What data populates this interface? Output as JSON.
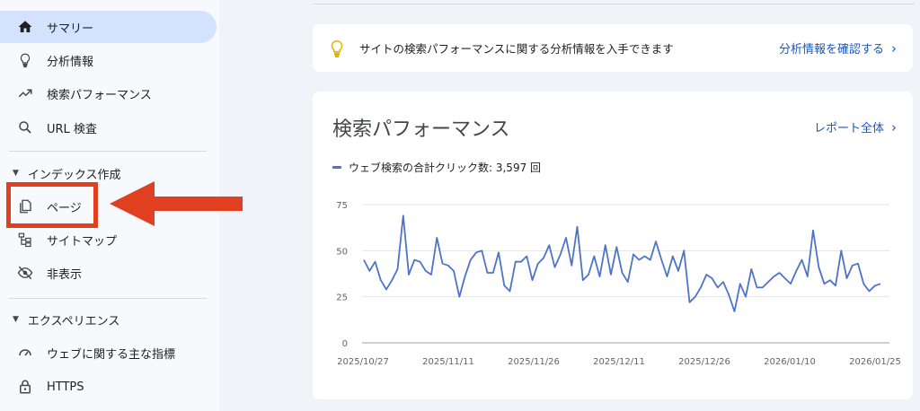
{
  "sidebar": {
    "items": [
      {
        "label": "サマリー",
        "icon": "home-icon",
        "active": true
      },
      {
        "label": "分析情報",
        "icon": "lightbulb-icon"
      },
      {
        "label": "検索パフォーマンス",
        "icon": "trending-up-icon"
      },
      {
        "label": "URL 検査",
        "icon": "search-icon"
      }
    ],
    "index_section": {
      "label": "インデックス作成",
      "items": [
        {
          "label": "ページ",
          "icon": "pages-icon"
        },
        {
          "label": "サイトマップ",
          "icon": "sitemap-icon"
        },
        {
          "label": "非表示",
          "icon": "visibility-off-icon"
        }
      ]
    },
    "experience_section": {
      "label": "エクスペリエンス",
      "items": [
        {
          "label": "ウェブに関する主な指標",
          "icon": "speed-gauge-icon"
        },
        {
          "label": "HTTPS",
          "icon": "lock-icon"
        }
      ]
    }
  },
  "annotation": {
    "color": "#e0401f"
  },
  "insight": {
    "text": "サイトの検索パフォーマンスに関する分析情報を入手できます",
    "link": "分析情報を確認する"
  },
  "performance": {
    "title": "検索パフォーマンス",
    "report_link": "レポート全体",
    "legend": "ウェブ検索の合計クリック数: 3,597 回"
  },
  "chart_data": {
    "type": "line",
    "x_tick_labels": [
      "2025/10/27",
      "2025/11/11",
      "2025/11/26",
      "2025/12/11",
      "2025/12/26",
      "2026/01/10",
      "2026/01/25"
    ],
    "y_ticks": [
      0,
      25,
      50,
      75
    ],
    "ylim": [
      0,
      75
    ],
    "grid": true,
    "color": "#4e73c9",
    "series": [
      {
        "values": [
          45,
          39,
          44,
          34,
          29,
          34,
          40,
          69,
          37,
          45,
          44,
          39,
          37,
          57,
          43,
          42,
          39,
          25,
          36,
          45,
          49,
          50,
          38,
          38,
          49,
          31,
          28,
          44,
          44,
          47,
          34,
          43,
          46,
          53,
          41,
          48,
          57,
          42,
          63,
          34,
          37,
          47,
          36,
          53,
          37,
          52,
          38,
          33,
          48,
          45,
          47,
          45,
          55,
          45,
          36,
          47,
          39,
          50,
          22,
          25,
          30,
          37,
          35,
          30,
          33,
          26,
          17,
          32,
          25,
          40,
          30,
          30,
          33,
          36,
          38,
          35,
          32,
          39,
          45,
          36,
          61,
          41,
          32,
          34,
          31,
          50,
          35,
          42,
          43,
          32,
          28,
          31,
          32
        ]
      }
    ]
  }
}
